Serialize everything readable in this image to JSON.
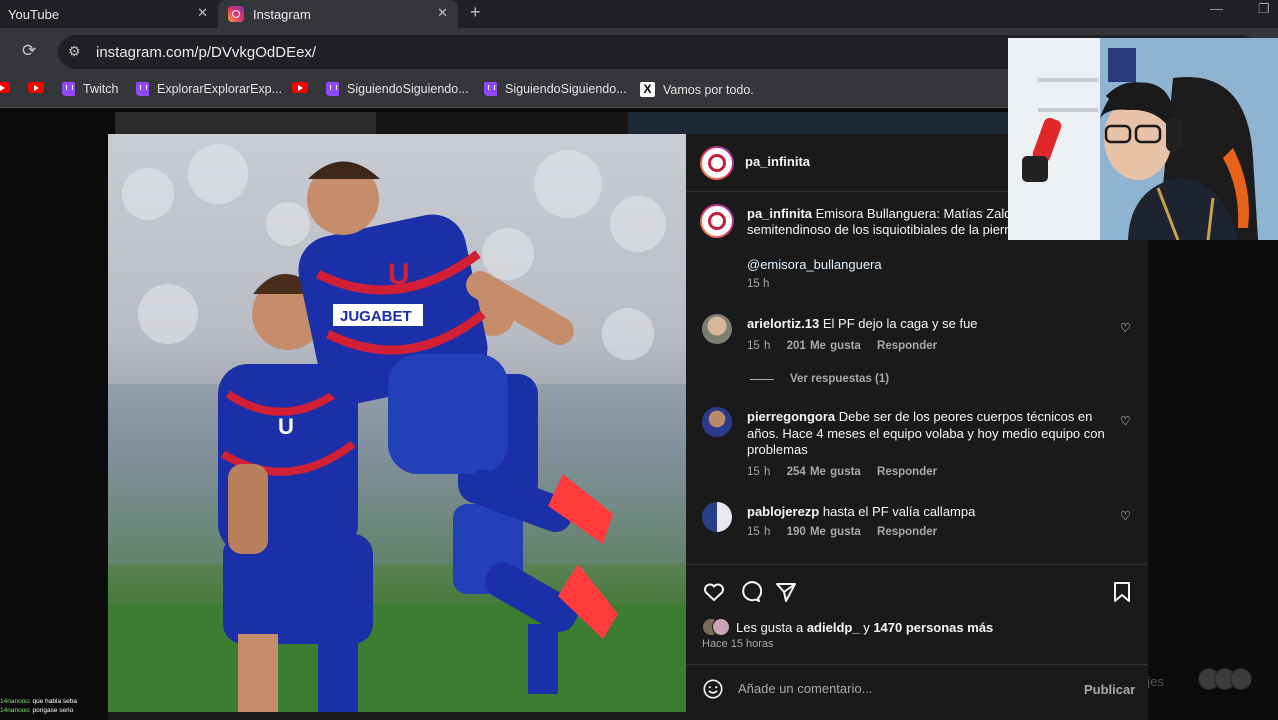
{
  "browser": {
    "tabs": [
      {
        "label": "YouTube",
        "close": "✕"
      },
      {
        "label": "Instagram",
        "close": "✕"
      }
    ],
    "new_tab": "+",
    "url": "instagram.com/p/DVvkgOdDEex/",
    "bookmarks": [
      "Twitch",
      "ExplorarExplorarExp...",
      "SiguiendoSiguiendo...",
      "SiguiendoSiguiendo...",
      "Vamos por todo."
    ]
  },
  "post": {
    "username": "pa_infinita",
    "caption": {
      "username": "pa_infinita",
      "text": "Emisora Bullanguera: Matías Zaldiv",
      "text_line2": "semitendinoso de los isquiotibiales de la piern",
      "mention": "@emisora_bullanguera",
      "time": "15 h"
    },
    "comments": [
      {
        "username": "arielortiz.13",
        "text": "El PF dejo la caga y se fue",
        "time": "15 h",
        "likes": "201 Me gusta",
        "reply": "Responder"
      },
      {
        "username": "pierregongora",
        "text": "Debe ser de los peores cuerpos técnicos en años. Hace 4 meses el equipo volaba y hoy medio equipo con problemas",
        "time": "15 h",
        "likes": "254 Me gusta",
        "reply": "Responder"
      },
      {
        "username": "pablojerezp",
        "text": "hasta el PF valía callampa",
        "time": "15 h",
        "likes": "190 Me gusta",
        "reply": "Responder"
      }
    ],
    "view_replies": "Ver respuestas (1)",
    "likes_prefix": "Les gusta a ",
    "likes_user": "adieldp_",
    "likes_middle": " y ",
    "likes_count": "1470 personas más",
    "posted": "Hace 15 horas",
    "comment_placeholder": "Añade un comentario...",
    "publish": "Publicar"
  },
  "background": {
    "partial_text": "ajes"
  },
  "stream_chat": [
    {
      "user": "14nanooo",
      "text": ": que habla seba"
    },
    {
      "user": "14nanooo",
      "text": ": pongase serio"
    }
  ],
  "colors": {
    "instagram_gradient": [
      "#f9a23b",
      "#e1306c",
      "#833ab4"
    ],
    "jersey_blue": "#1b2fa8",
    "jersey_red": "#d21f35"
  }
}
